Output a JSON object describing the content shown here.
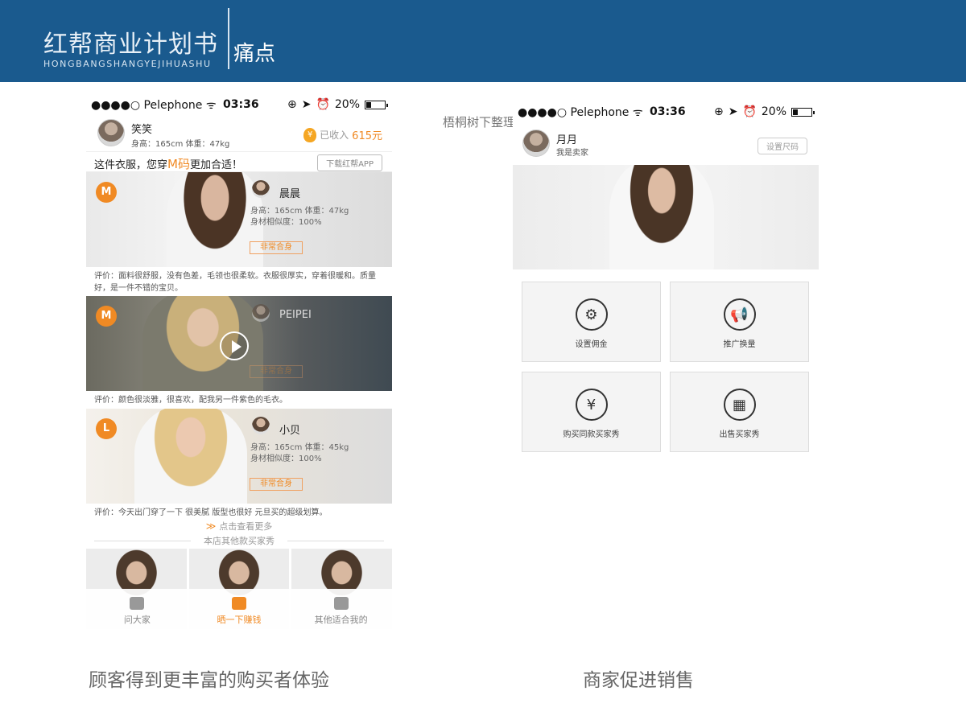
{
  "banner": {
    "brand_title": "红帮商业计划书",
    "brand_sub": "HONGBANGSHANGYEJIHUASHU",
    "section": "痛点"
  },
  "watermark": "梧桐树下整理",
  "captions": {
    "left": "顾客得到更丰富的购买者体验",
    "right": "商家促进销售"
  },
  "left_phone": {
    "status": {
      "carrier": "●●●●○ Pelephone ᯤ",
      "time": "03:36",
      "battery": "20%"
    },
    "user": {
      "name": "笑笑",
      "stats": "身高：165cm  体重：47kg"
    },
    "earnings": {
      "label": "已收入",
      "amount": "615元"
    },
    "promo": {
      "prefix": "这件衣服，您穿",
      "size": "M码",
      "suffix": "更加合适！",
      "download_btn": "下载红帮APP"
    },
    "cards": [
      {
        "size": "M",
        "name": "晨晨",
        "stats1": "身高：165cm  体重：47kg",
        "stats2": "身材相似度：100%",
        "tag": "非常合身",
        "review": "评价：面料很舒服，没有色差，毛领也很柔软。衣服很厚实，穿着很暖和。质量好，是一件不错的宝贝。"
      },
      {
        "size": "M",
        "name": "PEIPEI",
        "tag": "非常合身",
        "review": "评价：颜色很淡雅，很喜欢，配我另一件紫色的毛衣。"
      },
      {
        "size": "L",
        "name": "小贝",
        "stats1": "身高：165cm  体重：45kg",
        "stats2": "身材相似度：100%",
        "tag": "非常合身",
        "review": "评价：今天出门穿了一下 很美腻 版型也很好 元旦买的超级划算。"
      }
    ],
    "more": "点击查看更多",
    "section_title": "本店其他款买家秀",
    "tabs": [
      {
        "label": "问大家",
        "icon": "chat-icon"
      },
      {
        "label": "晒一下赚钱",
        "icon": "camera-icon"
      },
      {
        "label": "其他适合我的",
        "icon": "person-icon"
      }
    ]
  },
  "right_phone": {
    "status": {
      "carrier": "●●●●○ Pelephone ᯤ",
      "time": "03:36",
      "battery": "20%"
    },
    "seller": {
      "name": "月月",
      "role": "我是卖家"
    },
    "size_btn": "设置尺码",
    "tiles": [
      {
        "label": "设置佣金",
        "icon": "gear-icon",
        "glyph": "⚙"
      },
      {
        "label": "推广换量",
        "icon": "megaphone-icon",
        "glyph": "📢"
      },
      {
        "label": "购买同款买家秀",
        "icon": "money-bag-icon",
        "glyph": "¥"
      },
      {
        "label": "出售买家秀",
        "icon": "storefront-icon",
        "glyph": "▦"
      }
    ]
  }
}
